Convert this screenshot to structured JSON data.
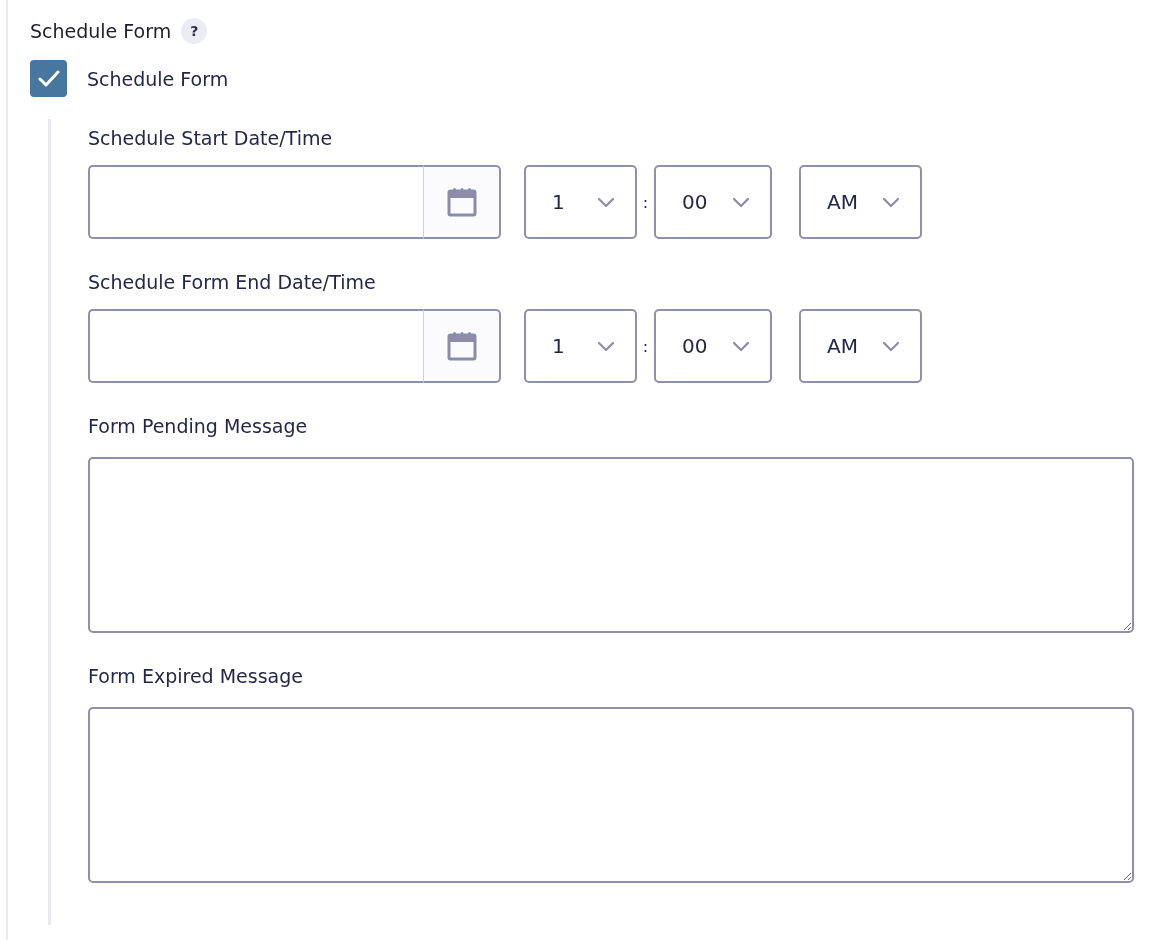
{
  "section": {
    "title": "Schedule Form",
    "help": "?"
  },
  "toggle": {
    "label": "Schedule Form",
    "checked": true
  },
  "datetimes": [
    {
      "label": "Schedule Start Date/Time",
      "hour": "1",
      "separator": ":",
      "minute": "00",
      "period": "AM"
    },
    {
      "label": "Schedule Form End Date/Time",
      "hour": "1",
      "separator": ":",
      "minute": "00",
      "period": "AM"
    }
  ],
  "messages": [
    {
      "label": "Form Pending Message"
    },
    {
      "label": "Form Expired Message"
    }
  ]
}
